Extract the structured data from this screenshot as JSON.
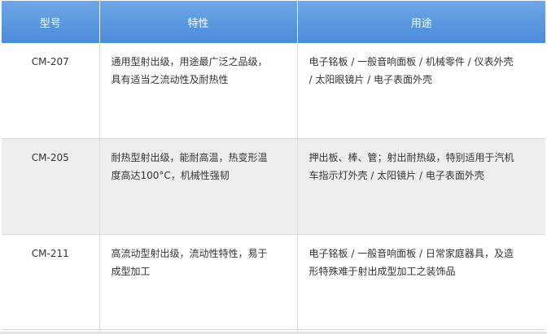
{
  "table": {
    "headers": [
      "型号",
      "特性",
      "用途"
    ],
    "rows": [
      {
        "model": "CM-207",
        "feature": "通用型射出级，用途最广泛之品级，\n具有适当之流动性及耐热性",
        "usage": "电子铭板 / 一般音响面板 / 机械零件 / 仪表外壳\n/ 太阳眼镜片 / 电子表面外壳"
      },
      {
        "model": "CM-205",
        "feature": "耐热型射出级，能耐高温，热变形温\n度高达100°C，机械性强韧",
        "usage": "押出板、棒、管；射出耐热级，特别适用于汽机\n车指示灯外壳 / 太阳镜片 / 电子表面外壳"
      },
      {
        "model": "CM-211",
        "feature": "高流动型射出级，流动性特性，易于\n成型加工",
        "usage": "电子铭板 / 一般音响面板 / 日常家庭器具，及造\n形特殊难于射出成型加工之装饰品"
      }
    ]
  },
  "colors": {
    "header_bg": "#4a8bdb",
    "header_text": "#ffffff",
    "alt_row_bg": "#eeeeee",
    "border": "#dddddd"
  }
}
